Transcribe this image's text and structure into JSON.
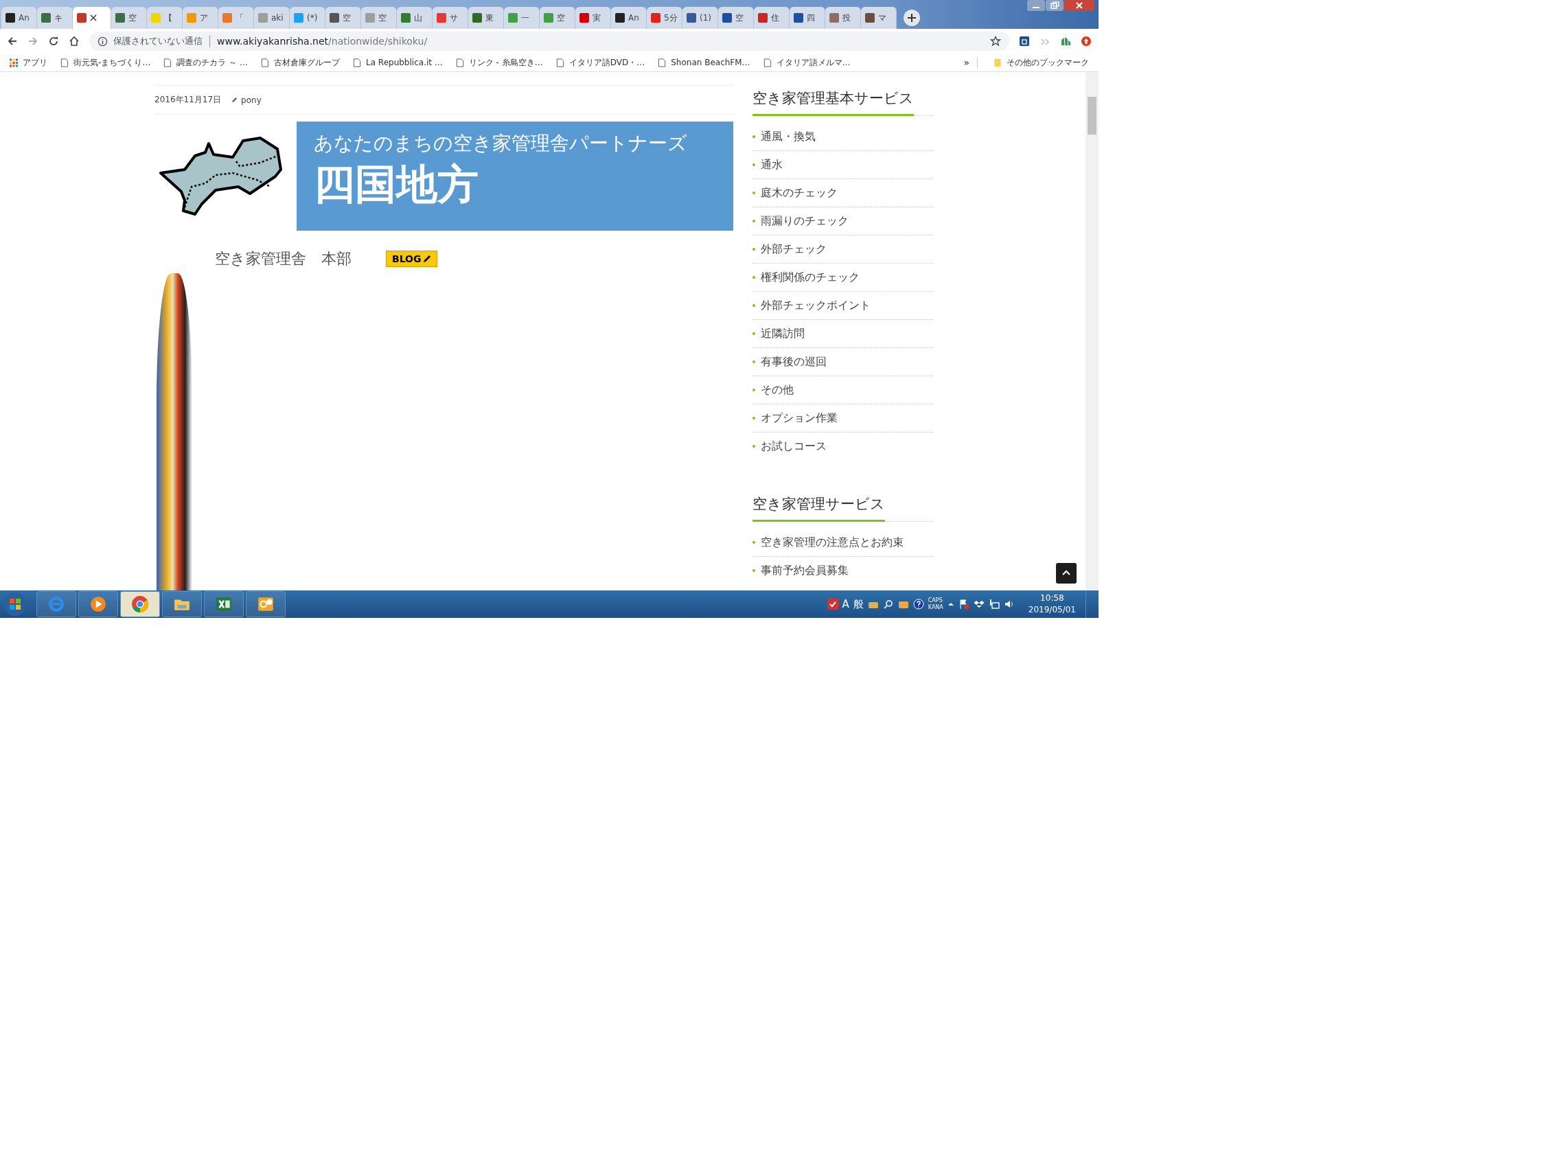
{
  "browser": {
    "tabs": [
      {
        "label": "An",
        "selected": false,
        "color": "#222222"
      },
      {
        "label": "キ",
        "selected": false,
        "color": "#3c6e47"
      },
      {
        "selected": true,
        "color": "#c0392b"
      },
      {
        "label": "空",
        "selected": false,
        "color": "#3c6e47"
      },
      {
        "label": "【",
        "selected": false,
        "color": "#f2d600"
      },
      {
        "label": "ア",
        "selected": false,
        "color": "#f29900"
      },
      {
        "label": "「",
        "selected": false,
        "color": "#e8782a"
      },
      {
        "label": "aki",
        "selected": false,
        "color": "#9e9e9e"
      },
      {
        "label": "(*)",
        "selected": false,
        "color": "#1da1f2"
      },
      {
        "label": "空",
        "selected": false,
        "color": "#555555"
      },
      {
        "label": "空",
        "selected": false,
        "color": "#9e9e9e"
      },
      {
        "label": "山",
        "selected": false,
        "color": "#2e7d32"
      },
      {
        "label": "サ",
        "selected": false,
        "color": "#e53935"
      },
      {
        "label": "東",
        "selected": false,
        "color": "#33691e"
      },
      {
        "label": "一",
        "selected": false,
        "color": "#43a047"
      },
      {
        "label": "空",
        "selected": false,
        "color": "#43a047"
      },
      {
        "label": "実",
        "selected": false,
        "color": "#d50000"
      },
      {
        "label": "An",
        "selected": false,
        "color": "#222222"
      },
      {
        "label": "5分",
        "selected": false,
        "color": "#e62117"
      },
      {
        "label": "(1)",
        "selected": false,
        "color": "#3b5998"
      },
      {
        "label": "空",
        "selected": false,
        "color": "#1e4fa0"
      },
      {
        "label": "住",
        "selected": false,
        "color": "#c62828"
      },
      {
        "label": "四",
        "selected": false,
        "color": "#1e4fa0"
      },
      {
        "label": "投",
        "selected": false,
        "color": "#8d6e63"
      },
      {
        "label": "マ",
        "selected": false,
        "color": "#6d4c41"
      }
    ],
    "security": "保護されていない通信",
    "url_host": "www.akiyakanrisha.net",
    "url_path": "/nationwide/shikoku/",
    "bookmarks": [
      "アプリ",
      "街元気-まちづくり…",
      "調査のチカラ ～ …",
      "古材倉庫グループ",
      "La Repubblica.it …",
      "リンク - 糸島空き…",
      "イタリア語DVD・…",
      "Shonan BeachFM…",
      "イタリア語メルマ…"
    ],
    "more": "»",
    "other_bookmarks": "その他のブックマーク"
  },
  "post": {
    "date": "2016年11月17日",
    "author": "pony",
    "banner_subtitle": "あなたのまちの空き家管理舎パートナーズ",
    "banner_title": "四国地方",
    "office": "空き家管理舎　本部",
    "blog_button": "BLOG"
  },
  "sidebar": [
    {
      "heading": "空き家管理基本サービス",
      "items": [
        "通風・換気",
        "通水",
        "庭木のチェック",
        "雨漏りのチェック",
        "外部チェック",
        "権利関係のチェック",
        "外部チェックポイント",
        "近隣訪問",
        "有事後の巡回",
        "その他",
        "オプション作業",
        "お試しコース"
      ]
    },
    {
      "heading": "空き家管理サービス",
      "items": [
        "空き家管理の注意点とお約束",
        "事前予約会員募集"
      ]
    }
  ],
  "taskbar": {
    "apps": [
      {
        "kind": "ie",
        "selected": false
      },
      {
        "kind": "media",
        "selected": false
      },
      {
        "kind": "chrome",
        "selected": true
      },
      {
        "kind": "explorer",
        "selected": false
      },
      {
        "kind": "excel",
        "selected": false
      },
      {
        "kind": "outlook",
        "selected": false
      }
    ],
    "ime_mode": "A",
    "ime_dict": "般",
    "caps": "CAPS",
    "kana": "KANA",
    "time": "10:58",
    "date": "2019/05/01"
  }
}
